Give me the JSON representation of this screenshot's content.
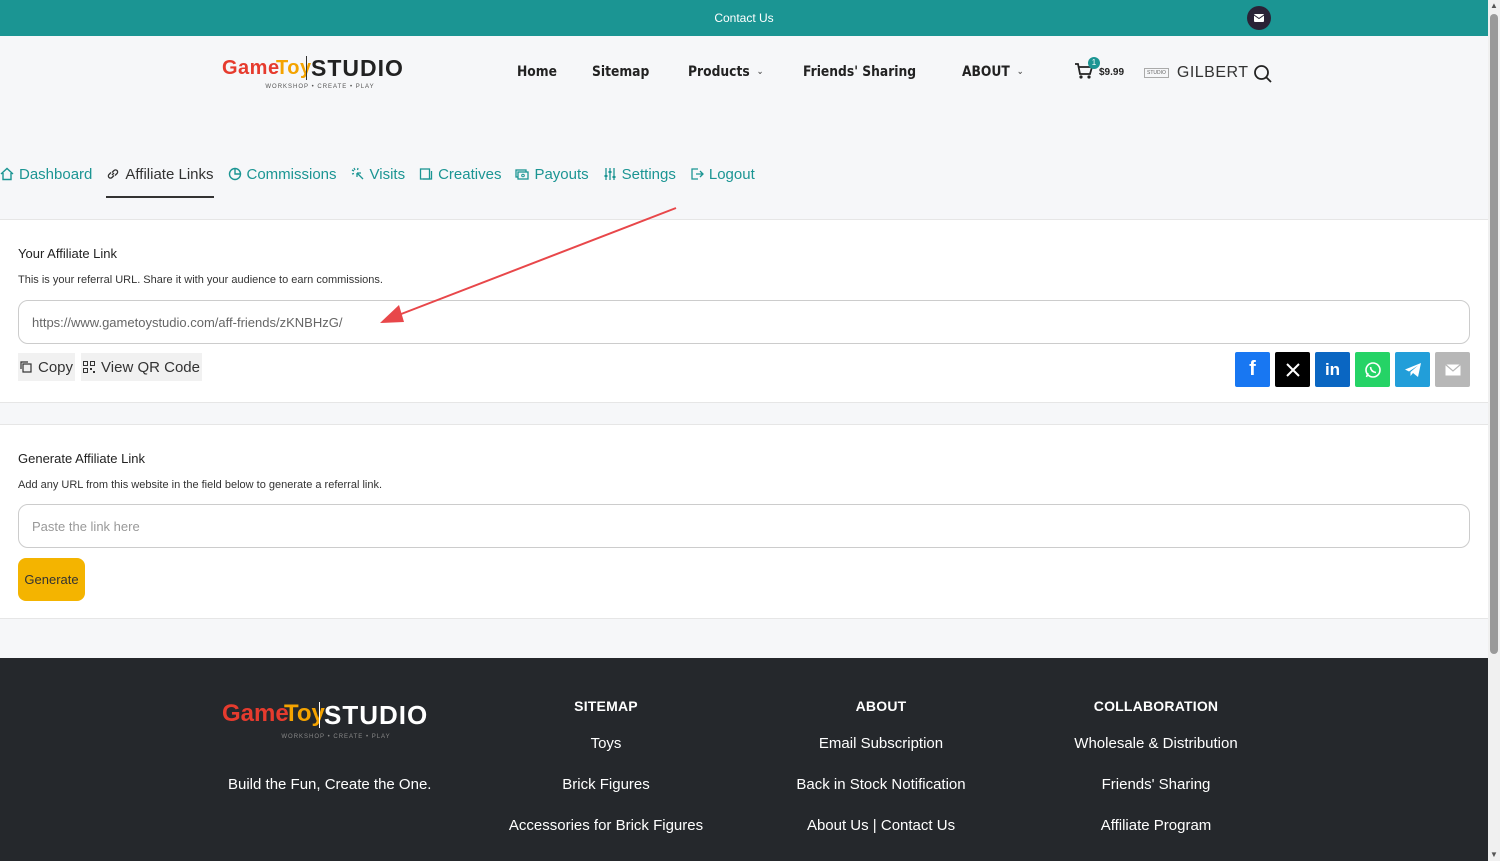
{
  "topbar": {
    "contact": "Contact Us"
  },
  "logo": {
    "game": "Game",
    "toy": "Toy",
    "studio": "STUDIO",
    "tagline": "WORKSHOP • CREATE • PLAY"
  },
  "nav": {
    "items": [
      {
        "label": "Home",
        "dropdown": false
      },
      {
        "label": "Sitemap",
        "dropdown": false
      },
      {
        "label": "Products",
        "dropdown": true
      },
      {
        "label": "Friends' Sharing",
        "dropdown": false
      },
      {
        "label": "ABOUT",
        "dropdown": true
      }
    ]
  },
  "cart": {
    "count": "1",
    "price": "$9.99"
  },
  "user": {
    "mini_logo": "STUDIO",
    "name": "GILBERT"
  },
  "tabs": [
    {
      "label": "Dashboard",
      "icon": "home-icon"
    },
    {
      "label": "Affiliate Links",
      "icon": "link-icon",
      "active": true
    },
    {
      "label": "Commissions",
      "icon": "pie-chart-icon"
    },
    {
      "label": "Visits",
      "icon": "click-icon"
    },
    {
      "label": "Creatives",
      "icon": "image-icon"
    },
    {
      "label": "Payouts",
      "icon": "money-icon"
    },
    {
      "label": "Settings",
      "icon": "sliders-icon"
    },
    {
      "label": "Logout",
      "icon": "logout-icon"
    }
  ],
  "affiliate_link": {
    "title": "Your Affiliate Link",
    "description": "This is your referral URL. Share it with your audience to earn commissions.",
    "url": "https://www.gametoystudio.com/aff-friends/zKNBHzG/",
    "copy_label": "Copy",
    "qr_label": "View QR Code",
    "share": [
      {
        "name": "facebook",
        "color": "#1877f2"
      },
      {
        "name": "x",
        "color": "#000000"
      },
      {
        "name": "linkedin",
        "color": "#0a66c2"
      },
      {
        "name": "whatsapp",
        "color": "#25d366"
      },
      {
        "name": "telegram",
        "color": "#229ed9"
      },
      {
        "name": "email",
        "color": "#b7b7b7"
      }
    ]
  },
  "generate": {
    "title": "Generate Affiliate Link",
    "description": "Add any URL from this website in the field below to generate a referral link.",
    "placeholder": "Paste the link here",
    "button": "Generate"
  },
  "footer": {
    "tagline": "Build the Fun, Create the One.",
    "sitemap": {
      "title": "SITEMAP",
      "links": [
        "Toys",
        "Brick Figures",
        "Accessories for Brick Figures"
      ]
    },
    "about": {
      "title": "ABOUT",
      "links": [
        "Email Subscription",
        "Back in Stock Notification",
        "About Us | Contact Us"
      ]
    },
    "collaboration": {
      "title": "COLLABORATION",
      "links": [
        "Wholesale & Distribution",
        "Friends' Sharing",
        "Affiliate Program"
      ]
    }
  },
  "colors": {
    "brand": "#1b9593",
    "generate_button": "#f4b400",
    "footer_bg": "#25282c",
    "arrow": "#e8474a"
  }
}
